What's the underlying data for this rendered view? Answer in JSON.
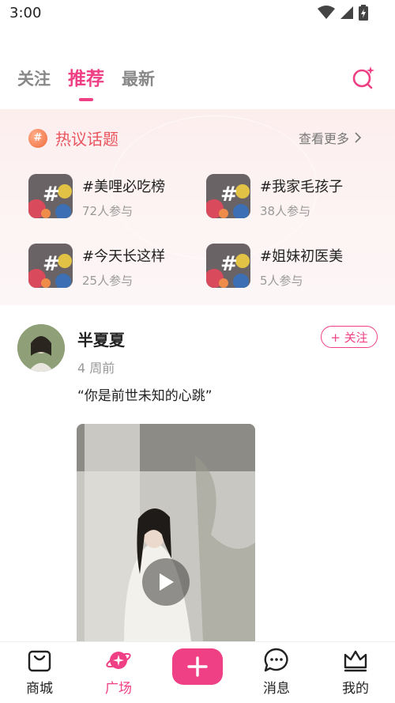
{
  "status_bar": {
    "time": "3:00"
  },
  "tabs": [
    {
      "label": "关注",
      "active": false
    },
    {
      "label": "推荐",
      "active": true
    },
    {
      "label": "最新",
      "active": false
    }
  ],
  "topics": {
    "title": "热议话题",
    "see_more": "查看更多",
    "items": [
      {
        "name": "#美哩必吃榜",
        "count": "72人参与"
      },
      {
        "name": "#我家毛孩子",
        "count": "38人参与"
      },
      {
        "name": "#今天长这样",
        "count": "25人参与"
      },
      {
        "name": "#姐妹初医美",
        "count": "5人参与"
      }
    ]
  },
  "post": {
    "username": "半夏夏",
    "time": "4 周前",
    "follow_label": "+ 关注",
    "text": "“你是前世未知的心跳”"
  },
  "bottom_nav": [
    {
      "label": "商城",
      "icon": "shopping-bag-icon",
      "active": false
    },
    {
      "label": "广场",
      "icon": "planet-icon",
      "active": true
    },
    {
      "label": "",
      "icon": "plus-icon",
      "active": false
    },
    {
      "label": "消息",
      "icon": "chat-bubble-icon",
      "active": false
    },
    {
      "label": "我的",
      "icon": "crown-icon",
      "active": false
    }
  ],
  "colors": {
    "accent": "#ef3f85",
    "topic_title": "#e9555f"
  }
}
